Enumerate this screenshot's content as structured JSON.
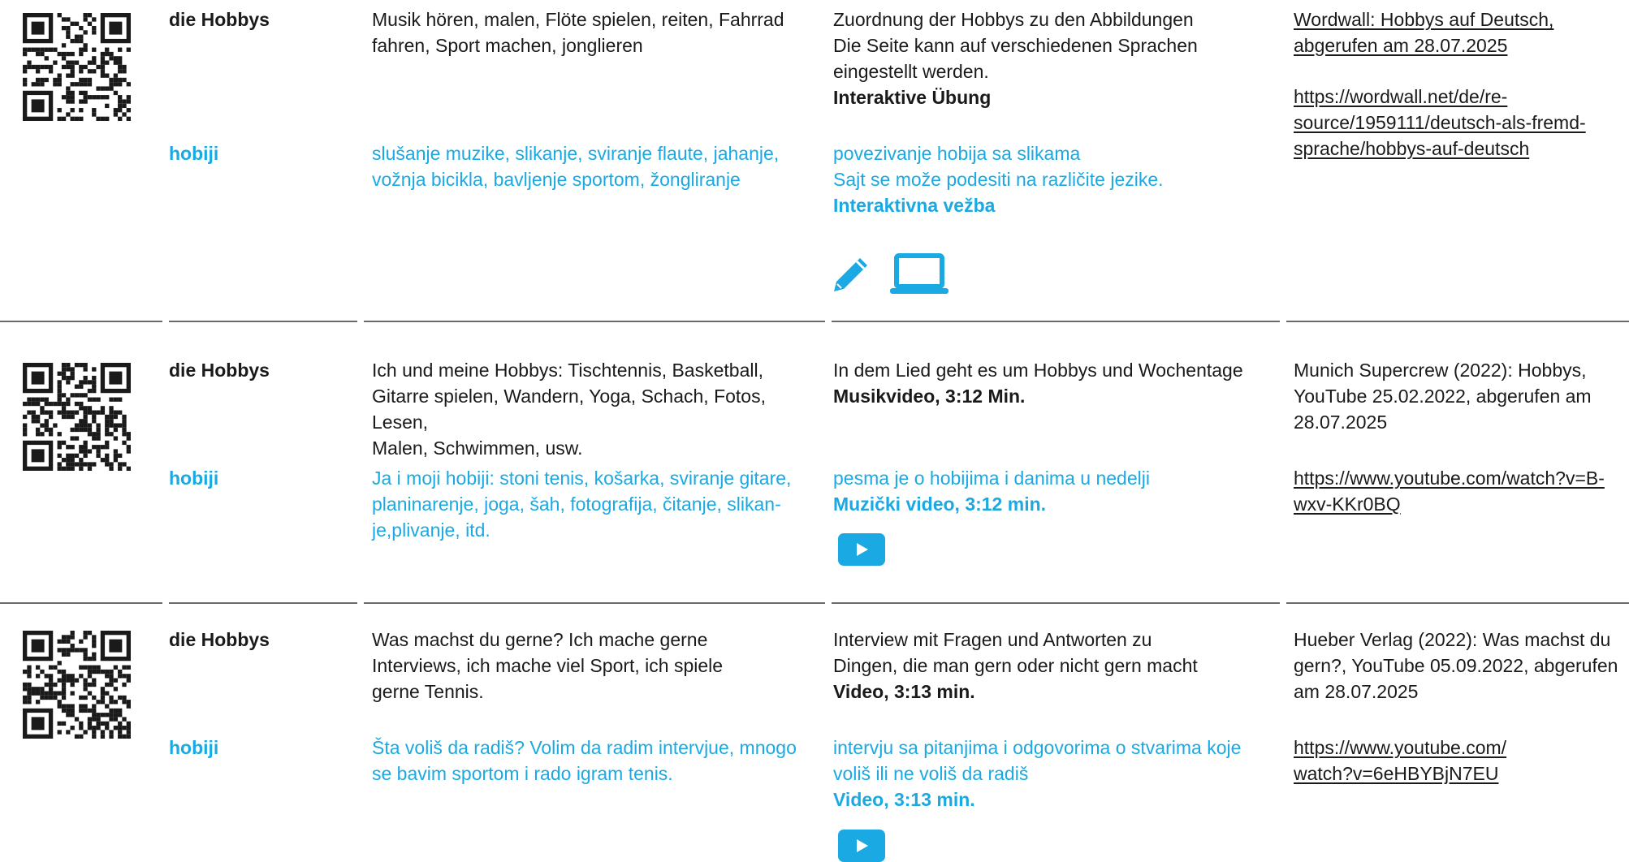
{
  "colors": {
    "accent": "#1aa9e2",
    "text": "#1a1a1a",
    "rule": "#6a6a6a"
  },
  "icons": {
    "qr": "qr-code-icon",
    "pencil": "pencil-icon",
    "laptop": "laptop-icon",
    "play": "play-icon"
  },
  "rows": [
    {
      "de_label": "die Hobbys",
      "sr_label": "hobiji",
      "de_topics": "Musik hören, malen, Flöte spielen, reiten, Fahrrad\nfahren, Sport machen, jonglieren",
      "sr_topics": "slušanje muzike, slikanje, sviranje flaute, jahanje,\nvožnja bicikla, bavljenje sportom, žongliranje",
      "de_desc": "Zuordnung der Hobbys zu den Abbildungen\nDie Seite kann auf verschiedenen Sprachen\neingestellt werden.",
      "de_type": "Interaktive Übung",
      "sr_desc": "povezivanje hobija sa slikama\nSajt se može podesiti na različite jezike.",
      "sr_type": "Interaktivna vežba",
      "source": "Wordwall: Hobbys auf Deutsch,\nabgerufen am 28.07.2025",
      "url": "https://wordwall.net/de/re-\nsource/1959111/deutsch-als-fremd-\nsprache/hobbys-auf-deutsch"
    },
    {
      "de_label": "die Hobbys",
      "sr_label": "hobiji",
      "de_topics": "Ich und meine Hobbys: Tischtennis, Basketball,\nGitarre spielen, Wandern, Yoga, Schach, Fotos, Lesen,\nMalen, Schwimmen, usw.",
      "sr_topics": "Ja i moji hobiji: stoni tenis, košarka, sviranje gitare,\nplaninarenje, joga, šah, fotografija, čitanje, slikan-\nje,plivanje, itd.",
      "de_desc": "In dem Lied geht es um Hobbys und Wochentage",
      "de_type": "Musikvideo, 3:12 Min.",
      "sr_desc": "pesma je o hobijima i danima u nedelji",
      "sr_type": "Muzički video, 3:12 min.",
      "source": "Munich Supercrew (2022): Hobbys,\nYouTube 25.02.2022, abgerufen am\n28.07.2025",
      "url": "https://www.youtube.com/watch?v=B-\nwxv-KKr0BQ"
    },
    {
      "de_label": "die Hobbys",
      "sr_label": "hobiji",
      "de_topics": "Was machst du gerne? Ich mache gerne\nInterviews, ich mache viel Sport, ich spiele\ngerne Tennis.",
      "sr_topics": "Šta voliš da radiš? Volim da radim intervjue, mnogo\nse bavim sportom i rado igram tenis.",
      "de_desc": "Interview mit Fragen und Antworten zu\nDingen, die man gern oder nicht gern macht",
      "de_type": "Video, 3:13 min.",
      "sr_desc": "intervju sa pitanjima i odgovorima o stvarima koje\nvoliš ili ne voliš da radiš",
      "sr_type": "Video, 3:13 min.",
      "source": "Hueber Verlag (2022): Was machst du\ngern?, YouTube 05.09.2022, abgerufen\nam 28.07.2025",
      "url": "https://www.youtube.com/\nwatch?v=6eHBYBjN7EU"
    }
  ]
}
